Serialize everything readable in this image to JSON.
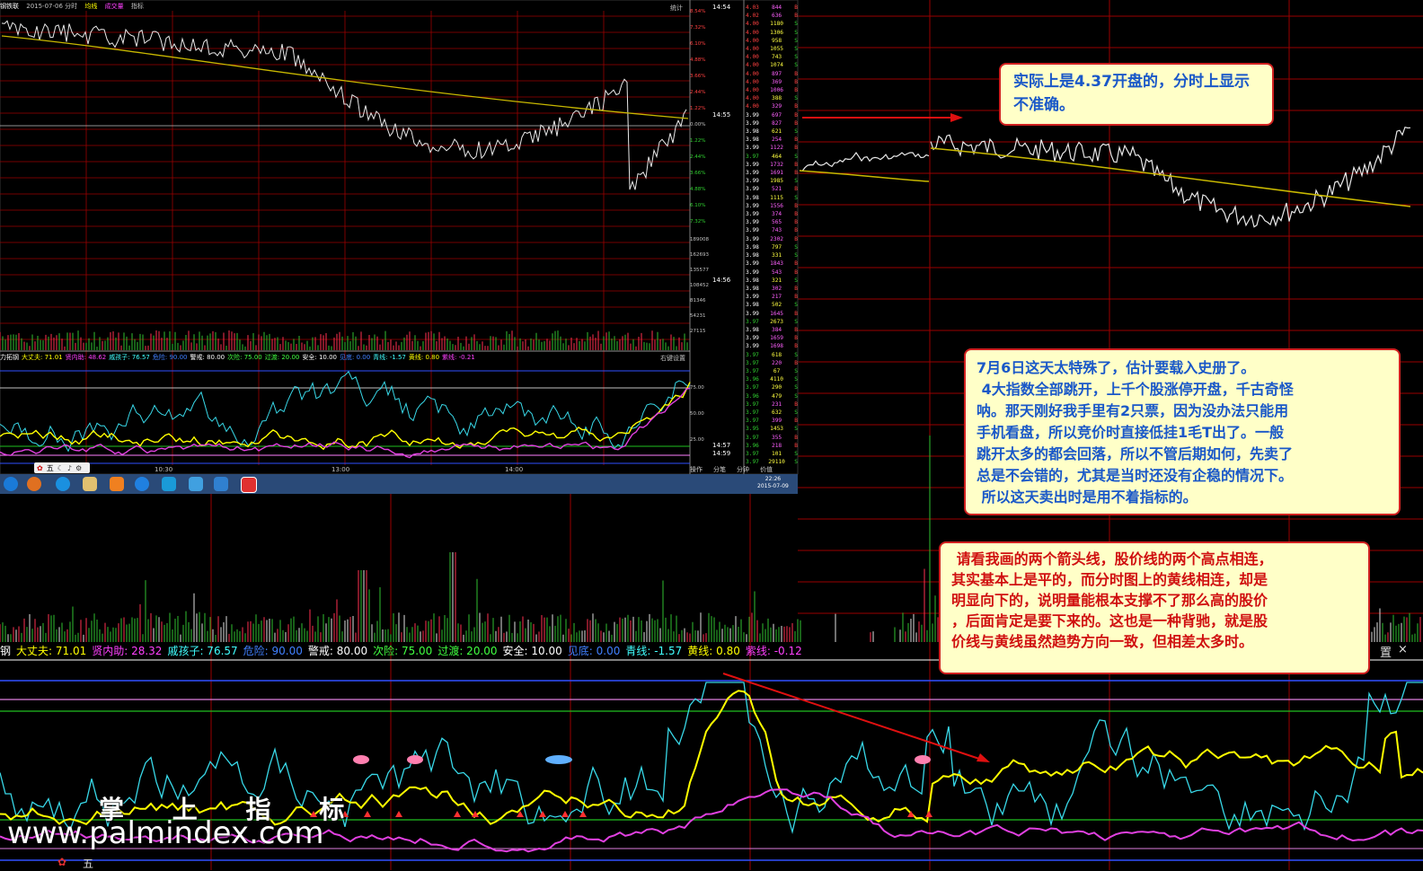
{
  "small_window": {
    "stock_name": "钢铁联",
    "date_label": "2015-07-06 分时",
    "tabs": [
      "均线",
      "成交量",
      "指标"
    ],
    "stats_label": "统计",
    "pct_ticks": [
      "8.54%",
      "7.32%",
      "6.10%",
      "4.88%",
      "3.66%",
      "2.44%",
      "1.22%",
      "0.00%",
      "1.22%",
      "2.44%",
      "3.66%",
      "4.88%",
      "6.10%",
      "7.32%"
    ],
    "vol_ticks": [
      "189008",
      "162693",
      "135577",
      "108452",
      "81346",
      "54231",
      "27115"
    ],
    "osc_ticks": [
      "75.00",
      "50.00",
      "25.00"
    ],
    "time_labels": [
      "10:30",
      "13:00",
      "14:00"
    ],
    "indicator_line": [
      {
        "label": "力拓钢",
        "color": "#ffffff"
      },
      {
        "label": "大丈夫: 71.01",
        "color": "#ffff00"
      },
      {
        "label": "贤内助: 48.62",
        "color": "#ff40ff"
      },
      {
        "label": "戚孩子: 76.57",
        "color": "#40ffff"
      },
      {
        "label": "危险: 90.00",
        "color": "#4080ff"
      },
      {
        "label": "警戒: 80.00",
        "color": "#ffffff"
      },
      {
        "label": "次险: 75.00",
        "color": "#40ff40"
      },
      {
        "label": "过渡: 20.00",
        "color": "#40ff40"
      },
      {
        "label": "安全: 10.00",
        "color": "#ffffff"
      },
      {
        "label": "见底: 0.00",
        "color": "#4080ff"
      },
      {
        "label": "青线: -1.57",
        "color": "#40ffff"
      },
      {
        "label": "黄线: 0.80",
        "color": "#ffff00"
      },
      {
        "label": "紫线: -0.21",
        "color": "#ff40ff"
      }
    ],
    "right_setting": "右键设置",
    "ticks_time_labels": [
      {
        "t": "14:54",
        "row": 0
      },
      {
        "t": "14:55",
        "row": 13
      },
      {
        "t": "14:56",
        "row": 33
      },
      {
        "t": "14:57",
        "row": 53
      },
      {
        "t": "14:59",
        "row": 54
      }
    ],
    "tick_rows": [
      [
        "4.03",
        "844",
        "B"
      ],
      [
        "4.02",
        "636",
        "B"
      ],
      [
        "4.00",
        "1180",
        "S"
      ],
      [
        "4.00",
        "1306",
        "S"
      ],
      [
        "4.00",
        "958",
        "S"
      ],
      [
        "4.00",
        "1055",
        "S"
      ],
      [
        "4.00",
        "743",
        "S"
      ],
      [
        "4.00",
        "1074",
        "S"
      ],
      [
        "4.00",
        "897",
        "B"
      ],
      [
        "4.00",
        "369",
        "B"
      ],
      [
        "4.00",
        "1006",
        "B"
      ],
      [
        "4.00",
        "388",
        "S"
      ],
      [
        "4.00",
        "329",
        "B"
      ],
      [
        "3.99",
        "697",
        "B"
      ],
      [
        "3.99",
        "827",
        "B"
      ],
      [
        "3.98",
        "621",
        "S"
      ],
      [
        "3.98",
        "254",
        "B"
      ],
      [
        "3.99",
        "1122",
        "B"
      ],
      [
        "3.97",
        "464",
        "S"
      ],
      [
        "3.99",
        "1732",
        "B"
      ],
      [
        "3.99",
        "1691",
        "B"
      ],
      [
        "3.99",
        "1985",
        "S"
      ],
      [
        "3.99",
        "521",
        "B"
      ],
      [
        "3.98",
        "1115",
        "S"
      ],
      [
        "3.99",
        "1556",
        "B"
      ],
      [
        "3.99",
        "374",
        "B"
      ],
      [
        "3.99",
        "565",
        "B"
      ],
      [
        "3.99",
        "743",
        "B"
      ],
      [
        "3.99",
        "2302",
        "B"
      ],
      [
        "3.98",
        "797",
        "S"
      ],
      [
        "3.98",
        "331",
        "S"
      ],
      [
        "3.99",
        "1843",
        "B"
      ],
      [
        "3.99",
        "543",
        "B"
      ],
      [
        "3.98",
        "321",
        "S"
      ],
      [
        "3.98",
        "302",
        "B"
      ],
      [
        "3.99",
        "217",
        "B"
      ],
      [
        "3.98",
        "502",
        "S"
      ],
      [
        "3.99",
        "1645",
        "B"
      ],
      [
        "3.97",
        "2673",
        "S"
      ],
      [
        "3.98",
        "384",
        "B"
      ],
      [
        "3.99",
        "1659",
        "B"
      ],
      [
        "3.99",
        "1698",
        "B"
      ],
      [
        "3.97",
        "618",
        "S"
      ],
      [
        "3.97",
        "220",
        "B"
      ],
      [
        "3.97",
        "67",
        "S"
      ],
      [
        "3.96",
        "4110",
        "S"
      ],
      [
        "3.97",
        "290",
        "S"
      ],
      [
        "3.96",
        "479",
        "S"
      ],
      [
        "3.97",
        "231",
        "B"
      ],
      [
        "3.97",
        "632",
        "S"
      ],
      [
        "3.97",
        "399",
        "B"
      ],
      [
        "3.95",
        "1453",
        "S"
      ],
      [
        "3.97",
        "355",
        "B"
      ],
      [
        "3.96",
        "218",
        "B"
      ],
      [
        "3.97",
        "101",
        "S"
      ],
      [
        "3.97",
        "29110",
        "S"
      ]
    ],
    "bottom_tabs": [
      "操作",
      "分笔",
      "分钟",
      "价值"
    ],
    "toolbar_label": "五",
    "clock_time": "22:26",
    "clock_date": "2015-07-09"
  },
  "main_chart": {
    "stock_name": "钢",
    "indicator_line": [
      {
        "label": "大丈夫: 71.01",
        "color": "#ffff00"
      },
      {
        "label": "贤内助: 28.32",
        "color": "#ff40ff"
      },
      {
        "label": "戚孩子: 76.57",
        "color": "#40ffff"
      },
      {
        "label": "危险: 90.00",
        "color": "#4080ff"
      },
      {
        "label": "警戒: 80.00",
        "color": "#ffffff"
      },
      {
        "label": "次险: 75.00",
        "color": "#40ff40"
      },
      {
        "label": "过渡: 20.00",
        "color": "#40ff40"
      },
      {
        "label": "安全: 10.00",
        "color": "#ffffff"
      },
      {
        "label": "见底: 0.00",
        "color": "#4080ff"
      },
      {
        "label": "青线: -1.57",
        "color": "#40ffff"
      },
      {
        "label": "黄线: 0.80",
        "color": "#ffff00"
      },
      {
        "label": "紫线: -0.12",
        "color": "#ff40ff"
      }
    ],
    "corner_label": "置",
    "close_glyph": "×"
  },
  "annotations": {
    "note1": "实际上是4.37开盘的，分时上显示不准确。",
    "note2_lines": [
      "7月6日这天太特殊了，估计要载入史册了。",
      " 4大指数全部跳开，上千个股涨停开盘，千古奇怪",
      "呐。那天刚好我手里有2只票，因为没办法只能用",
      "手机看盘，所以竞价时直接低挂1毛T出了。一般",
      "跳开太多的都会回落，所以不管后期如何，先卖了",
      "总是不会错的，尤其是当时还没有企稳的情况下。",
      " 所以这天卖出时是用不着指标的。"
    ],
    "note3_lines": [
      " 请看我画的两个箭头线，股价线的两个高点相连，",
      "其实基本上是平的，而分时图上的黄线相连，却是",
      "明显向下的，说明量能根本支撑不了那么高的股价",
      "，后面肯定是要下来的。这也是一种背驰，就是股",
      "价线与黄线虽然趋势方向一致，但相差太多时。"
    ]
  },
  "watermark": {
    "title": "掌 上 指 标",
    "url": "www.palmindex.com"
  },
  "colors": {
    "grid_red": "#9a0000",
    "price_line": "#e8e8e8",
    "avg_line": "#c8b800",
    "cyan": "#38d8e8",
    "yellow": "#ffff00",
    "magenta": "#e040e0",
    "green_line": "#20c020",
    "blue_line": "#3050ff",
    "pink_line": "#e080e0",
    "arrow_red": "#e01010"
  }
}
